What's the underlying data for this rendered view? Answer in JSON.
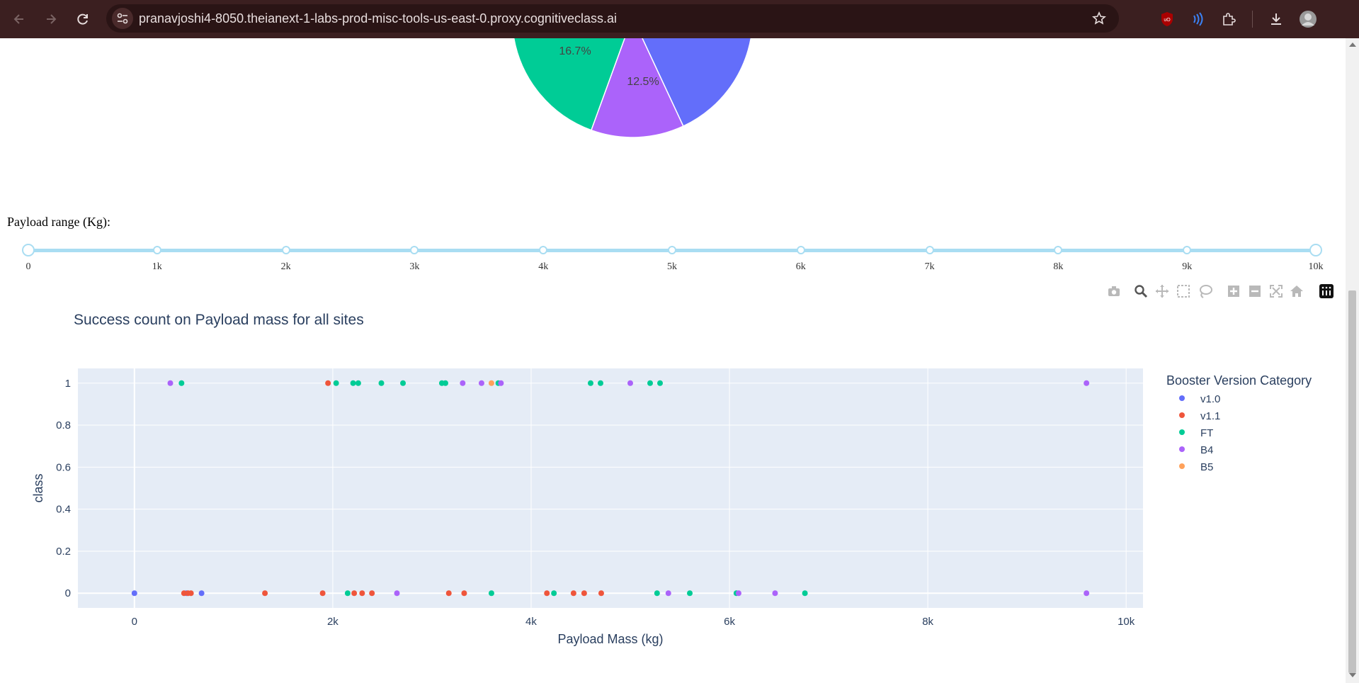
{
  "browser": {
    "url": "pranavjoshi4-8050.theianext-1-labs-prod-misc-tools-us-east-0.proxy.cognitiveclass.ai",
    "icons": [
      "back-icon",
      "forward-icon",
      "reload-icon",
      "site-settings-icon",
      "bookmark-star-icon",
      "ublock-icon",
      "extension-icon",
      "extensions-puzzle-icon",
      "downloads-icon",
      "profile-avatar"
    ]
  },
  "pie": {
    "slices": [
      {
        "label": "16.7%",
        "value": 16.7,
        "color": "#00cc96"
      },
      {
        "label": "12.5%",
        "value": 12.5,
        "color": "#ab63fa"
      }
    ],
    "partial_color": "#636efa"
  },
  "slider": {
    "label": "Payload range (Kg):",
    "min": 0,
    "max": 10000,
    "value": [
      0,
      10000
    ],
    "step_marks": 1000,
    "marks": [
      "0",
      "1k",
      "2k",
      "3k",
      "4k",
      "5k",
      "6k",
      "7k",
      "8k",
      "9k",
      "10k"
    ],
    "track_color": "#a9ddf2"
  },
  "modebar": [
    "camera-icon",
    "zoom-icon",
    "pan-icon",
    "box-select-icon",
    "lasso-icon",
    "zoom-in-icon",
    "zoom-out-icon",
    "autoscale-icon",
    "reset-axes-icon",
    "plotly-logo-icon"
  ],
  "chart_data": {
    "type": "scatter",
    "title": "Success count on Payload mass for all sites",
    "xlabel": "Payload Mass (kg)",
    "ylabel": "class",
    "xlim": [
      -570,
      10170
    ],
    "ylim": [
      -0.07,
      1.07
    ],
    "xticks": [
      0,
      2000,
      4000,
      6000,
      8000,
      10000
    ],
    "xtick_labels": [
      "0",
      "2k",
      "4k",
      "6k",
      "8k",
      "10k"
    ],
    "yticks": [
      0,
      0.2,
      0.4,
      0.6,
      0.8,
      1
    ],
    "ytick_labels": [
      "0",
      "0.2",
      "0.4",
      "0.6",
      "0.8",
      "1"
    ],
    "grid": true,
    "legend_title": "Booster Version Category",
    "legend_position": "right",
    "series": [
      {
        "name": "v1.0",
        "color": "#636efa",
        "points": [
          [
            0,
            0
          ],
          [
            525,
            0
          ],
          [
            677,
            0
          ]
        ]
      },
      {
        "name": "v1.1",
        "color": "#ef553b",
        "points": [
          [
            500,
            0
          ],
          [
            540,
            0
          ],
          [
            570,
            0
          ],
          [
            1316,
            0
          ],
          [
            1898,
            0
          ],
          [
            2216,
            0
          ],
          [
            2296,
            0
          ],
          [
            2395,
            0
          ],
          [
            3170,
            0
          ],
          [
            3325,
            0
          ],
          [
            4159,
            0
          ],
          [
            4428,
            0
          ],
          [
            4535,
            0
          ],
          [
            4707,
            0
          ],
          [
            1952,
            1
          ]
        ]
      },
      {
        "name": "FT",
        "color": "#00cc96",
        "points": [
          [
            475,
            1
          ],
          [
            2034,
            1
          ],
          [
            2205,
            1
          ],
          [
            2257,
            1
          ],
          [
            2490,
            1
          ],
          [
            2708,
            1
          ],
          [
            3100,
            1
          ],
          [
            3136,
            1
          ],
          [
            3669,
            1
          ],
          [
            4600,
            1
          ],
          [
            4700,
            1
          ],
          [
            5200,
            1
          ],
          [
            5300,
            1
          ],
          [
            2150,
            0
          ],
          [
            3600,
            0
          ],
          [
            4230,
            0
          ],
          [
            5270,
            0
          ],
          [
            5600,
            0
          ],
          [
            6070,
            0
          ],
          [
            6761,
            0
          ]
        ]
      },
      {
        "name": "B4",
        "color": "#ab63fa",
        "points": [
          [
            362,
            1
          ],
          [
            3310,
            1
          ],
          [
            3500,
            1
          ],
          [
            3696,
            1
          ],
          [
            5000,
            1
          ],
          [
            9600,
            1
          ],
          [
            2647,
            0
          ],
          [
            5384,
            0
          ],
          [
            6092,
            0
          ],
          [
            6460,
            0
          ],
          [
            9600,
            0
          ]
        ]
      },
      {
        "name": "B5",
        "color": "#ffa15a",
        "points": [
          [
            3600,
            1
          ]
        ]
      }
    ]
  }
}
